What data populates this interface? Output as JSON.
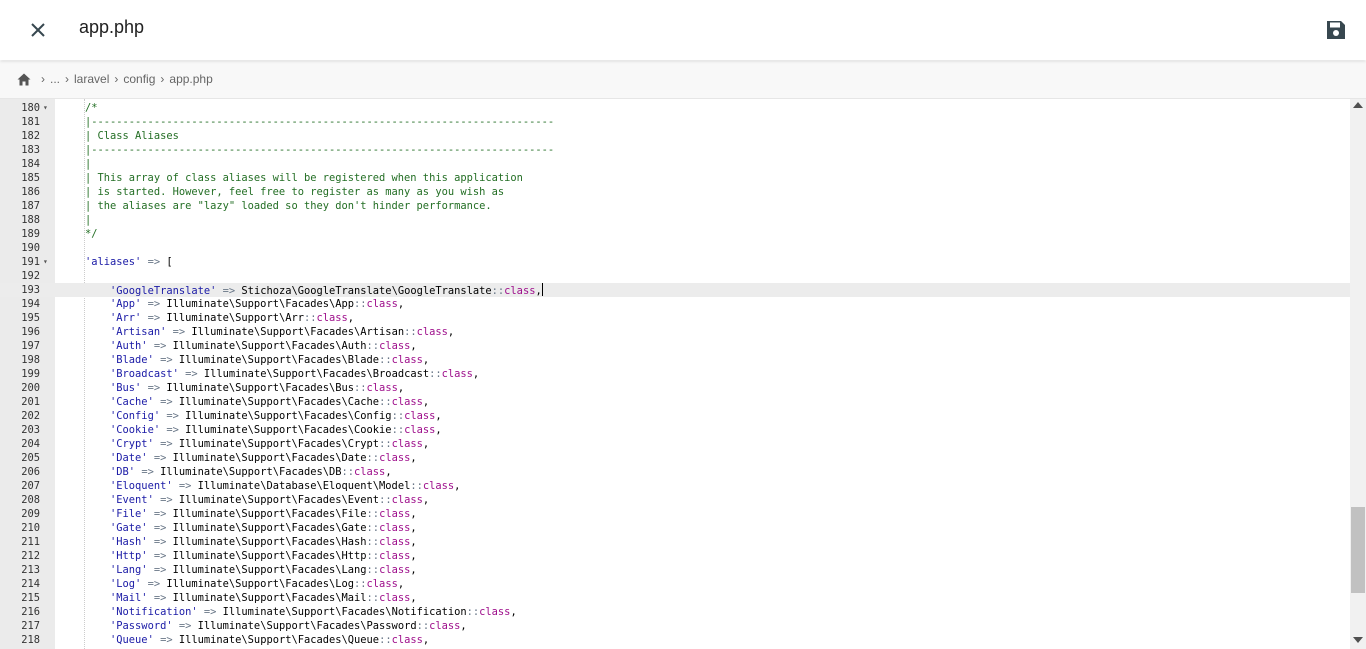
{
  "header": {
    "title": "app.php",
    "close_icon": "close-icon",
    "save_icon": "save-icon"
  },
  "breadcrumb": {
    "home_icon": "home-icon",
    "items": [
      "...",
      "laravel",
      "config",
      "app.php"
    ]
  },
  "editor": {
    "lines": [
      {
        "n": "180",
        "fold": true,
        "code": [
          [
            "c",
            "/*"
          ]
        ]
      },
      {
        "n": "181",
        "code": [
          [
            "c",
            "|--------------------------------------------------------------------------"
          ]
        ]
      },
      {
        "n": "182",
        "code": [
          [
            "c",
            "| Class Aliases"
          ]
        ]
      },
      {
        "n": "183",
        "code": [
          [
            "c",
            "|--------------------------------------------------------------------------"
          ]
        ]
      },
      {
        "n": "184",
        "code": [
          [
            "c",
            "|"
          ]
        ]
      },
      {
        "n": "185",
        "code": [
          [
            "c",
            "| This array of class aliases will be registered when this application"
          ]
        ]
      },
      {
        "n": "186",
        "code": [
          [
            "c",
            "| is started. However, feel free to register as many as you wish as"
          ]
        ]
      },
      {
        "n": "187",
        "code": [
          [
            "c",
            "| the aliases are \"lazy\" loaded so they don't hinder performance."
          ]
        ]
      },
      {
        "n": "188",
        "code": [
          [
            "c",
            "|"
          ]
        ]
      },
      {
        "n": "189",
        "code": [
          [
            "c",
            "*/"
          ]
        ]
      },
      {
        "n": "190",
        "code": []
      },
      {
        "n": "191",
        "fold": true,
        "code": [
          [
            "s",
            "'aliases'"
          ],
          [
            "t",
            " "
          ],
          [
            "op",
            "=>"
          ],
          [
            "t",
            " ["
          ]
        ]
      },
      {
        "n": "192",
        "code": []
      },
      {
        "n": "193",
        "active": true,
        "code": [
          [
            "t",
            "    "
          ],
          [
            "s",
            "'GoogleTranslate'"
          ],
          [
            "t",
            " "
          ],
          [
            "op",
            "=>"
          ],
          [
            "t",
            " Stichoza\\GoogleTranslate\\GoogleTranslate"
          ],
          [
            "op",
            "::"
          ],
          [
            "kw",
            "class"
          ],
          [
            "t",
            ","
          ]
        ]
      },
      {
        "n": "194",
        "code": [
          [
            "t",
            "    "
          ],
          [
            "s",
            "'App'"
          ],
          [
            "t",
            " "
          ],
          [
            "op",
            "=>"
          ],
          [
            "t",
            " Illuminate\\Support\\Facades\\App"
          ],
          [
            "op",
            "::"
          ],
          [
            "kw",
            "class"
          ],
          [
            "t",
            ","
          ]
        ]
      },
      {
        "n": "195",
        "code": [
          [
            "t",
            "    "
          ],
          [
            "s",
            "'Arr'"
          ],
          [
            "t",
            " "
          ],
          [
            "op",
            "=>"
          ],
          [
            "t",
            " Illuminate\\Support\\Arr"
          ],
          [
            "op",
            "::"
          ],
          [
            "kw",
            "class"
          ],
          [
            "t",
            ","
          ]
        ]
      },
      {
        "n": "196",
        "code": [
          [
            "t",
            "    "
          ],
          [
            "s",
            "'Artisan'"
          ],
          [
            "t",
            " "
          ],
          [
            "op",
            "=>"
          ],
          [
            "t",
            " Illuminate\\Support\\Facades\\Artisan"
          ],
          [
            "op",
            "::"
          ],
          [
            "kw",
            "class"
          ],
          [
            "t",
            ","
          ]
        ]
      },
      {
        "n": "197",
        "code": [
          [
            "t",
            "    "
          ],
          [
            "s",
            "'Auth'"
          ],
          [
            "t",
            " "
          ],
          [
            "op",
            "=>"
          ],
          [
            "t",
            " Illuminate\\Support\\Facades\\Auth"
          ],
          [
            "op",
            "::"
          ],
          [
            "kw",
            "class"
          ],
          [
            "t",
            ","
          ]
        ]
      },
      {
        "n": "198",
        "code": [
          [
            "t",
            "    "
          ],
          [
            "s",
            "'Blade'"
          ],
          [
            "t",
            " "
          ],
          [
            "op",
            "=>"
          ],
          [
            "t",
            " Illuminate\\Support\\Facades\\Blade"
          ],
          [
            "op",
            "::"
          ],
          [
            "kw",
            "class"
          ],
          [
            "t",
            ","
          ]
        ]
      },
      {
        "n": "199",
        "code": [
          [
            "t",
            "    "
          ],
          [
            "s",
            "'Broadcast'"
          ],
          [
            "t",
            " "
          ],
          [
            "op",
            "=>"
          ],
          [
            "t",
            " Illuminate\\Support\\Facades\\Broadcast"
          ],
          [
            "op",
            "::"
          ],
          [
            "kw",
            "class"
          ],
          [
            "t",
            ","
          ]
        ]
      },
      {
        "n": "200",
        "code": [
          [
            "t",
            "    "
          ],
          [
            "s",
            "'Bus'"
          ],
          [
            "t",
            " "
          ],
          [
            "op",
            "=>"
          ],
          [
            "t",
            " Illuminate\\Support\\Facades\\Bus"
          ],
          [
            "op",
            "::"
          ],
          [
            "kw",
            "class"
          ],
          [
            "t",
            ","
          ]
        ]
      },
      {
        "n": "201",
        "code": [
          [
            "t",
            "    "
          ],
          [
            "s",
            "'Cache'"
          ],
          [
            "t",
            " "
          ],
          [
            "op",
            "=>"
          ],
          [
            "t",
            " Illuminate\\Support\\Facades\\Cache"
          ],
          [
            "op",
            "::"
          ],
          [
            "kw",
            "class"
          ],
          [
            "t",
            ","
          ]
        ]
      },
      {
        "n": "202",
        "code": [
          [
            "t",
            "    "
          ],
          [
            "s",
            "'Config'"
          ],
          [
            "t",
            " "
          ],
          [
            "op",
            "=>"
          ],
          [
            "t",
            " Illuminate\\Support\\Facades\\Config"
          ],
          [
            "op",
            "::"
          ],
          [
            "kw",
            "class"
          ],
          [
            "t",
            ","
          ]
        ]
      },
      {
        "n": "203",
        "code": [
          [
            "t",
            "    "
          ],
          [
            "s",
            "'Cookie'"
          ],
          [
            "t",
            " "
          ],
          [
            "op",
            "=>"
          ],
          [
            "t",
            " Illuminate\\Support\\Facades\\Cookie"
          ],
          [
            "op",
            "::"
          ],
          [
            "kw",
            "class"
          ],
          [
            "t",
            ","
          ]
        ]
      },
      {
        "n": "204",
        "code": [
          [
            "t",
            "    "
          ],
          [
            "s",
            "'Crypt'"
          ],
          [
            "t",
            " "
          ],
          [
            "op",
            "=>"
          ],
          [
            "t",
            " Illuminate\\Support\\Facades\\Crypt"
          ],
          [
            "op",
            "::"
          ],
          [
            "kw",
            "class"
          ],
          [
            "t",
            ","
          ]
        ]
      },
      {
        "n": "205",
        "code": [
          [
            "t",
            "    "
          ],
          [
            "s",
            "'Date'"
          ],
          [
            "t",
            " "
          ],
          [
            "op",
            "=>"
          ],
          [
            "t",
            " Illuminate\\Support\\Facades\\Date"
          ],
          [
            "op",
            "::"
          ],
          [
            "kw",
            "class"
          ],
          [
            "t",
            ","
          ]
        ]
      },
      {
        "n": "206",
        "code": [
          [
            "t",
            "    "
          ],
          [
            "s",
            "'DB'"
          ],
          [
            "t",
            " "
          ],
          [
            "op",
            "=>"
          ],
          [
            "t",
            " Illuminate\\Support\\Facades\\DB"
          ],
          [
            "op",
            "::"
          ],
          [
            "kw",
            "class"
          ],
          [
            "t",
            ","
          ]
        ]
      },
      {
        "n": "207",
        "code": [
          [
            "t",
            "    "
          ],
          [
            "s",
            "'Eloquent'"
          ],
          [
            "t",
            " "
          ],
          [
            "op",
            "=>"
          ],
          [
            "t",
            " Illuminate\\Database\\Eloquent\\Model"
          ],
          [
            "op",
            "::"
          ],
          [
            "kw",
            "class"
          ],
          [
            "t",
            ","
          ]
        ]
      },
      {
        "n": "208",
        "code": [
          [
            "t",
            "    "
          ],
          [
            "s",
            "'Event'"
          ],
          [
            "t",
            " "
          ],
          [
            "op",
            "=>"
          ],
          [
            "t",
            " Illuminate\\Support\\Facades\\Event"
          ],
          [
            "op",
            "::"
          ],
          [
            "kw",
            "class"
          ],
          [
            "t",
            ","
          ]
        ]
      },
      {
        "n": "209",
        "code": [
          [
            "t",
            "    "
          ],
          [
            "s",
            "'File'"
          ],
          [
            "t",
            " "
          ],
          [
            "op",
            "=>"
          ],
          [
            "t",
            " Illuminate\\Support\\Facades\\File"
          ],
          [
            "op",
            "::"
          ],
          [
            "kw",
            "class"
          ],
          [
            "t",
            ","
          ]
        ]
      },
      {
        "n": "210",
        "code": [
          [
            "t",
            "    "
          ],
          [
            "s",
            "'Gate'"
          ],
          [
            "t",
            " "
          ],
          [
            "op",
            "=>"
          ],
          [
            "t",
            " Illuminate\\Support\\Facades\\Gate"
          ],
          [
            "op",
            "::"
          ],
          [
            "kw",
            "class"
          ],
          [
            "t",
            ","
          ]
        ]
      },
      {
        "n": "211",
        "code": [
          [
            "t",
            "    "
          ],
          [
            "s",
            "'Hash'"
          ],
          [
            "t",
            " "
          ],
          [
            "op",
            "=>"
          ],
          [
            "t",
            " Illuminate\\Support\\Facades\\Hash"
          ],
          [
            "op",
            "::"
          ],
          [
            "kw",
            "class"
          ],
          [
            "t",
            ","
          ]
        ]
      },
      {
        "n": "212",
        "code": [
          [
            "t",
            "    "
          ],
          [
            "s",
            "'Http'"
          ],
          [
            "t",
            " "
          ],
          [
            "op",
            "=>"
          ],
          [
            "t",
            " Illuminate\\Support\\Facades\\Http"
          ],
          [
            "op",
            "::"
          ],
          [
            "kw",
            "class"
          ],
          [
            "t",
            ","
          ]
        ]
      },
      {
        "n": "213",
        "code": [
          [
            "t",
            "    "
          ],
          [
            "s",
            "'Lang'"
          ],
          [
            "t",
            " "
          ],
          [
            "op",
            "=>"
          ],
          [
            "t",
            " Illuminate\\Support\\Facades\\Lang"
          ],
          [
            "op",
            "::"
          ],
          [
            "kw",
            "class"
          ],
          [
            "t",
            ","
          ]
        ]
      },
      {
        "n": "214",
        "code": [
          [
            "t",
            "    "
          ],
          [
            "s",
            "'Log'"
          ],
          [
            "t",
            " "
          ],
          [
            "op",
            "=>"
          ],
          [
            "t",
            " Illuminate\\Support\\Facades\\Log"
          ],
          [
            "op",
            "::"
          ],
          [
            "kw",
            "class"
          ],
          [
            "t",
            ","
          ]
        ]
      },
      {
        "n": "215",
        "code": [
          [
            "t",
            "    "
          ],
          [
            "s",
            "'Mail'"
          ],
          [
            "t",
            " "
          ],
          [
            "op",
            "=>"
          ],
          [
            "t",
            " Illuminate\\Support\\Facades\\Mail"
          ],
          [
            "op",
            "::"
          ],
          [
            "kw",
            "class"
          ],
          [
            "t",
            ","
          ]
        ]
      },
      {
        "n": "216",
        "code": [
          [
            "t",
            "    "
          ],
          [
            "s",
            "'Notification'"
          ],
          [
            "t",
            " "
          ],
          [
            "op",
            "=>"
          ],
          [
            "t",
            " Illuminate\\Support\\Facades\\Notification"
          ],
          [
            "op",
            "::"
          ],
          [
            "kw",
            "class"
          ],
          [
            "t",
            ","
          ]
        ]
      },
      {
        "n": "217",
        "code": [
          [
            "t",
            "    "
          ],
          [
            "s",
            "'Password'"
          ],
          [
            "t",
            " "
          ],
          [
            "op",
            "=>"
          ],
          [
            "t",
            " Illuminate\\Support\\Facades\\Password"
          ],
          [
            "op",
            "::"
          ],
          [
            "kw",
            "class"
          ],
          [
            "t",
            ","
          ]
        ]
      },
      {
        "n": "218",
        "code": [
          [
            "t",
            "    "
          ],
          [
            "s",
            "'Queue'"
          ],
          [
            "t",
            " "
          ],
          [
            "op",
            "=>"
          ],
          [
            "t",
            " Illuminate\\Support\\Facades\\Queue"
          ],
          [
            "op",
            "::"
          ],
          [
            "kw",
            "class"
          ],
          [
            "t",
            ","
          ]
        ]
      }
    ]
  }
}
